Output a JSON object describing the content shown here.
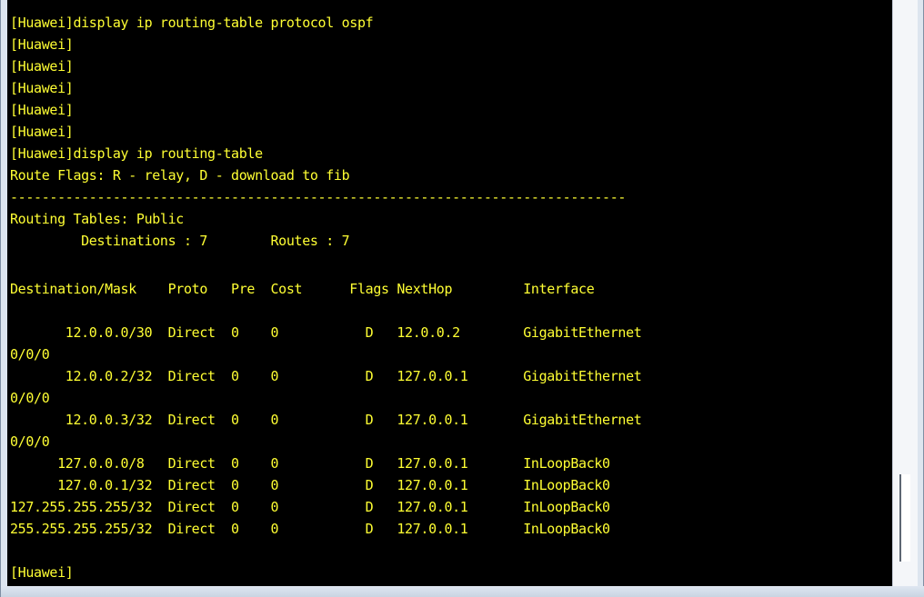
{
  "terminal": {
    "text_color": "#ffff33",
    "background": "#000000",
    "lines": [
      "[Huawei]display ip routing-table protocol ospf",
      "[Huawei]",
      "[Huawei]",
      "[Huawei]",
      "[Huawei]",
      "[Huawei]",
      "[Huawei]display ip routing-table",
      "Route Flags: R - relay, D - download to fib",
      "------------------------------------------------------------------------------",
      "Routing Tables: Public",
      "         Destinations : 7        Routes : 7",
      "",
      "Destination/Mask    Proto   Pre  Cost      Flags NextHop         Interface",
      "",
      "       12.0.0.0/30  Direct  0    0           D   12.0.0.2        GigabitEthernet",
      "0/0/0",
      "       12.0.0.2/32  Direct  0    0           D   127.0.0.1       GigabitEthernet",
      "0/0/0",
      "       12.0.0.3/32  Direct  0    0           D   127.0.0.1       GigabitEthernet",
      "0/0/0",
      "      127.0.0.0/8   Direct  0    0           D   127.0.0.1       InLoopBack0",
      "      127.0.0.1/32  Direct  0    0           D   127.0.0.1       InLoopBack0",
      "127.255.255.255/32  Direct  0    0           D   127.0.0.1       InLoopBack0",
      "255.255.255.255/32  Direct  0    0           D   127.0.0.1       InLoopBack0",
      "",
      "[Huawei]"
    ]
  }
}
